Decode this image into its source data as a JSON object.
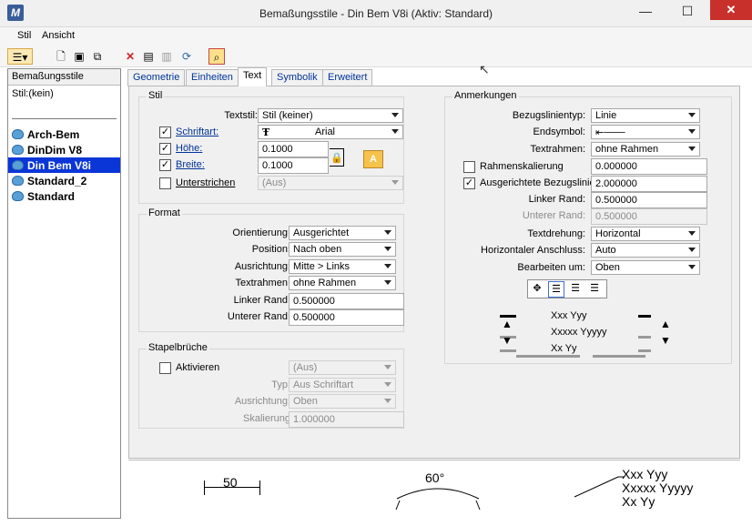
{
  "window": {
    "title": "Bemaßungsstile -  Din Bem V8i (Aktiv: Standard)",
    "minimize": "—",
    "maximize": "☐",
    "close": "✕"
  },
  "menu": {
    "items": [
      "Stil",
      "Ansicht"
    ]
  },
  "leftpane": {
    "header": "Bemaßungsstile",
    "current": "Stil:(kein)",
    "styles": [
      "Arch-Bem",
      "DinDim V8",
      "Din Bem V8i",
      "Standard_2",
      "Standard"
    ],
    "selected": "Din Bem V8i"
  },
  "tabs": [
    "Geometrie",
    "Einheiten",
    "Text",
    "Symbolik",
    "Erweitert"
  ],
  "active_tab": "Text",
  "stil": {
    "title": "Stil",
    "textstil_label": "Textstil:",
    "textstil_value": "Stil (keiner)",
    "schriftart_label": "Schriftart:",
    "schriftart_value": "Arial",
    "schriftart_icon": "Ŧ",
    "hoehe_label": "Höhe:",
    "hoehe_value": "0.1000",
    "breite_label": "Breite:",
    "breite_value": "0.1000",
    "unterstrichen_label": "Unterstrichen",
    "unterstrichen_value": "(Aus)"
  },
  "format": {
    "title": "Format",
    "rows": [
      {
        "label": "Orientierung:",
        "value": "Ausgerichtet",
        "type": "select"
      },
      {
        "label": "Position:",
        "value": "Nach oben",
        "type": "select"
      },
      {
        "label": "Ausrichtung:",
        "value": "Mitte > Links",
        "type": "select"
      },
      {
        "label": "Textrahmen:",
        "value": "ohne Rahmen",
        "type": "select"
      },
      {
        "label": "Linker Rand:",
        "value": "0.500000",
        "type": "input"
      },
      {
        "label": "Unterer Rand:",
        "value": "0.500000",
        "type": "input"
      }
    ]
  },
  "stapel": {
    "title": "Stapelbrüche",
    "aktivieren_label": "Aktivieren",
    "aktivieren_value": "(Aus)",
    "typ_label": "Typ:",
    "typ_value": "Aus Schriftart",
    "ausrichtung_label": "Ausrichtung:",
    "ausrichtung_value": "Oben",
    "skalierung_label": "Skalierung",
    "skalierung_value": "1.000000"
  },
  "anmerkungen": {
    "title": "Anmerkungen",
    "bezugslinientyp_label": "Bezugslinientyp:",
    "bezugslinientyp_value": "Linie",
    "endsymbol_label": "Endsymbol:",
    "textrahmen_label": "Textrahmen:",
    "textrahmen_value": "ohne Rahmen",
    "rahmenskalierung_label": "Rahmenskalierung",
    "rahmenskalierung_value": "0.000000",
    "ausgerichtete_label": "Ausgerichtete Bezugslinie",
    "ausgerichtete_value": "2.000000",
    "linker_label": "Linker Rand:",
    "linker_value": "0.500000",
    "unterer_label": "Unterer Rand:",
    "unterer_value": "0.500000",
    "textdrehung_label": "Textdrehung:",
    "textdrehung_value": "Horizontal",
    "anschluss_label": "Horizontaler Anschluss:",
    "anschluss_value": "Auto",
    "bearbeiten_label": "Bearbeiten um:",
    "bearbeiten_value": "Oben",
    "sample_lines": [
      "Xxx Yyy",
      "Xxxxx Yyyyy",
      "Xx Yy"
    ]
  },
  "preview": {
    "dim_value": "50",
    "angle_value": "60°",
    "note_lines": [
      "Xxx Yyy",
      "Xxxxx Yyyyy",
      "Xx Yy"
    ]
  }
}
